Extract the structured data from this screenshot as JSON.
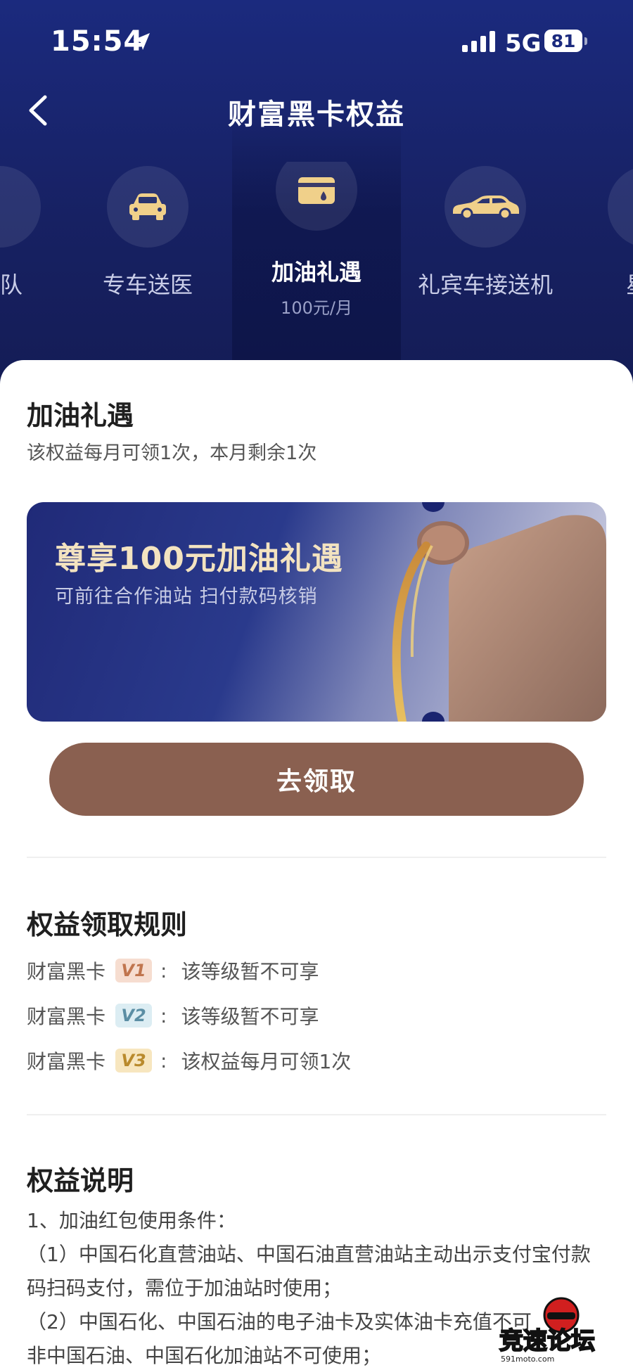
{
  "status_bar": {
    "time": "15:54",
    "network": "5G",
    "battery": "81"
  },
  "nav": {
    "title": "财富黑卡权益"
  },
  "tabs": [
    {
      "label": "专家团队",
      "visible_text": "团队",
      "icon": "team-icon"
    },
    {
      "label": "专车送医",
      "icon": "car-icon"
    },
    {
      "label": "加油礼遇",
      "sub": "100元/月",
      "icon": "fuel-card-icon",
      "active": true
    },
    {
      "label": "礼宾车接送机",
      "icon": "sedan-icon"
    },
    {
      "label": "星巴克",
      "visible_text": "星巴",
      "icon": "coffee-icon"
    }
  ],
  "benefit": {
    "title": "加油礼遇",
    "subtitle": "该权益每月可领1次，本月剩余1次",
    "banner_title": "尊享100元加油礼遇",
    "banner_subtitle": "可前往合作油站 扫付款码核销",
    "cta_label": "去领取"
  },
  "rules": {
    "title": "权益领取规则",
    "rows": [
      {
        "card": "财富黑卡",
        "level": "V1",
        "level_bg": "#f6ddd0",
        "level_color": "#c0754e",
        "text": "该等级暂不可享"
      },
      {
        "card": "财富黑卡",
        "level": "V2",
        "level_bg": "#dcedf3",
        "level_color": "#5b8ea4",
        "text": "该等级暂不可享"
      },
      {
        "card": "财富黑卡",
        "level": "V3",
        "level_bg": "#f7e6bf",
        "level_color": "#b98a2c",
        "text": "该权益每月可领1次"
      }
    ]
  },
  "description": {
    "title": "权益说明",
    "lines": [
      "1、加油红包使用条件：",
      "（1）中国石化直营油站、中国石油直营油站主动出示支付宝付款",
      "码扫码支付，需位于加油站时使用；",
      "（2）中国石化、中国石油的电子油卡及实体油卡充值不可",
      "非中国石油、中国石化加油站不可使用；"
    ]
  },
  "watermark": {
    "text": "竞速论坛",
    "site": "591moto.com"
  },
  "colors": {
    "header_bg": "#1b2a7e",
    "cta_bg": "#8a6050",
    "banner_title": "#f3e3c0",
    "icon_gold": "#f0d08a"
  }
}
